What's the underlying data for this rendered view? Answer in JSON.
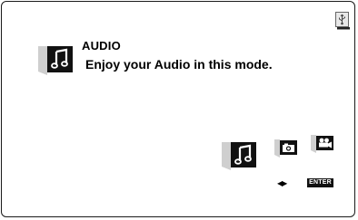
{
  "mode": {
    "title": "AUDIO",
    "description": "Enjoy your Audio in this mode."
  },
  "modes": [
    {
      "name": "audio",
      "icon": "music-note-icon",
      "selected": true
    },
    {
      "name": "photo",
      "icon": "photo-camera-icon",
      "selected": false
    },
    {
      "name": "video",
      "icon": "video-camera-icon",
      "selected": false
    }
  ],
  "device": {
    "icon": "usb-icon"
  },
  "hints": {
    "arrows": "◀▶",
    "enter": "ENTER"
  }
}
